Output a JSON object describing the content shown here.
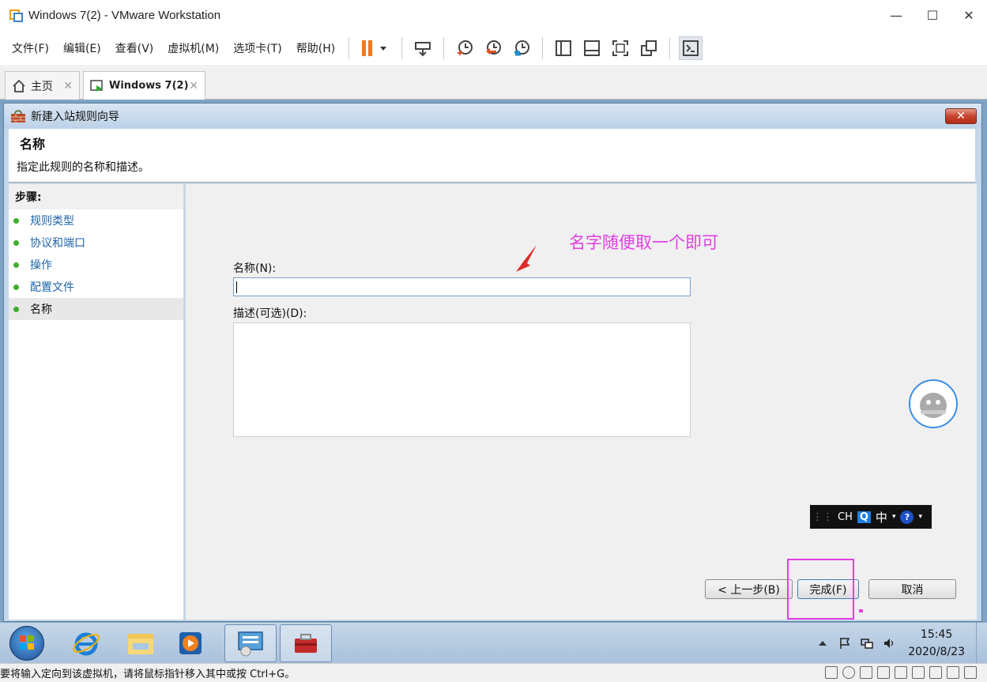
{
  "window": {
    "title": "Windows 7(2) - VMware Workstation",
    "min": "—",
    "max": "☐",
    "close": "✕"
  },
  "menu": [
    "文件(F)",
    "编辑(E)",
    "查看(V)",
    "虚拟机(M)",
    "选项卡(T)",
    "帮助(H)"
  ],
  "tabs": {
    "home": "主页",
    "active": "Windows 7(2)",
    "close": "✕"
  },
  "wizard": {
    "title": "新建入站规则向导",
    "close": "✕",
    "header_title": "名称",
    "header_desc": "指定此规则的名称和描述。",
    "steps_label": "步骤:",
    "steps": [
      "规则类型",
      "协议和端口",
      "操作",
      "配置文件",
      "名称"
    ],
    "name_label": "名称(N):",
    "name_value": "",
    "desc_label": "描述(可选)(D):",
    "desc_value": "",
    "annotation": "名字随便取一个即可",
    "back_button": "< 上一步(B)",
    "finish_button": "完成(F)",
    "cancel_button": "取消"
  },
  "ime": {
    "lang": "CH",
    "mode": "中"
  },
  "taskbar": {
    "time": "15:45",
    "date": "2020/8/23"
  },
  "status": {
    "text": "要将输入定向到该虚拟机，请将鼠标指针移入其中或按 Ctrl+G。"
  },
  "colors": {
    "annotation": "#e040e0",
    "step_link": "#1e63a8",
    "step_dot": "#3fae2a"
  }
}
